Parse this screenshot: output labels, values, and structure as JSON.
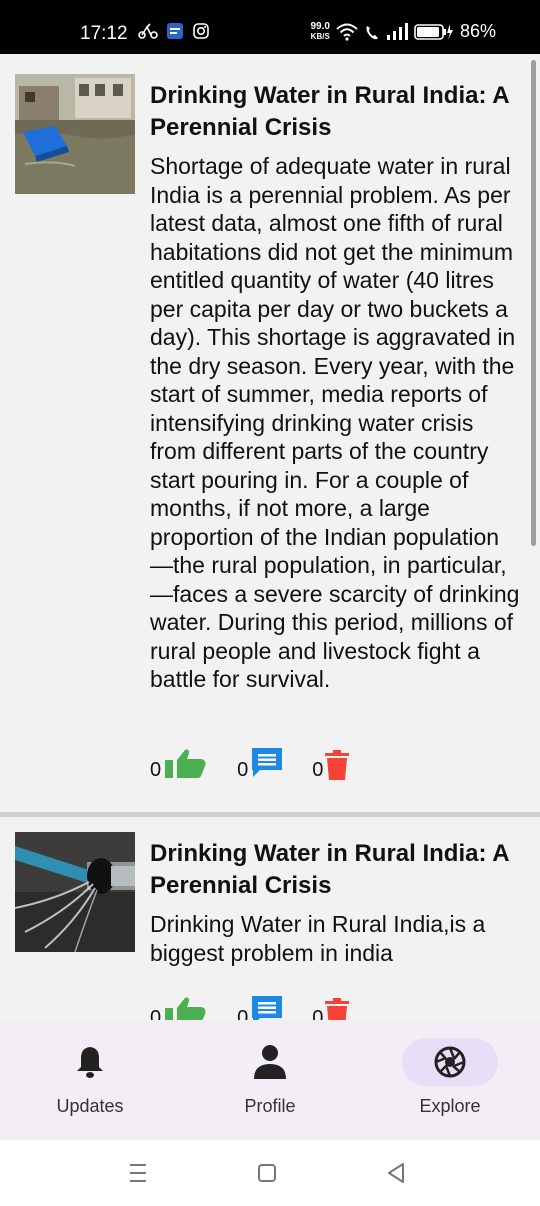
{
  "status_bar": {
    "time": "17:12",
    "speed_value": "99.0",
    "speed_unit": "KB/S",
    "battery": "86%"
  },
  "posts": [
    {
      "title": "Drinking Water in Rural India: A Perennial Crisis",
      "body": "Shortage of adequate water in rural India is a perennial problem. As per latest data, almost one fifth of rural habitations did not get the minimum entitled quantity of water (40 litres per capita per day or two buckets  a day). This shortage is aggravated in the dry season. Every year, with the start of summer, media reports of intensifying drinking water crisis from different parts of the country start pouring in. For a couple of months, if not more, a large proportion of the Indian population—the rural population, in particular,—faces a severe scarcity of drinking water.  During this period, millions of rural people and livestock fight a battle for survival.",
      "likes": "0",
      "comments": "0",
      "deletes": "0"
    },
    {
      "title": "Drinking Water in Rural India: A Perennial Crisis",
      "body": "Drinking Water in Rural India,is a biggest problem in india",
      "likes": "0",
      "comments": "0",
      "deletes": "0"
    }
  ],
  "bottom_nav": {
    "updates": "Updates",
    "profile": "Profile",
    "explore": "Explore"
  },
  "colors": {
    "like": "#4caf50",
    "comment": "#1e88e5",
    "delete": "#f44336",
    "active_nav_pill": "#e8def8"
  }
}
